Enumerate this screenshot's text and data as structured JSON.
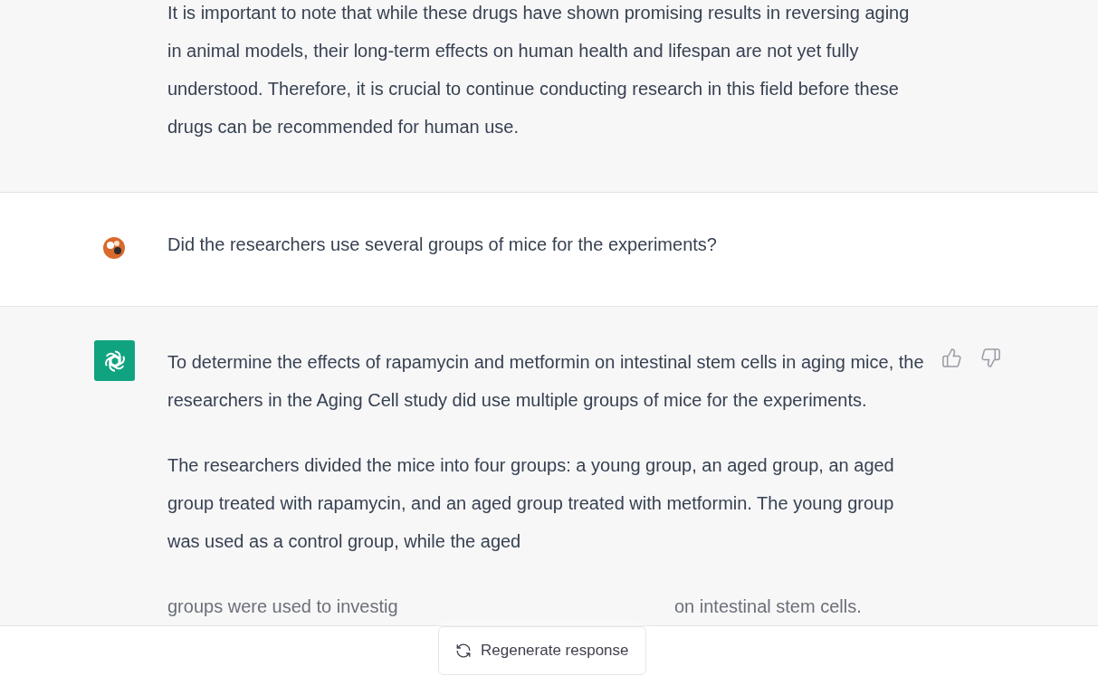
{
  "messages": [
    {
      "kind": "assistant",
      "paragraphs": [
        "It is important to note that while these drugs have shown promising results in reversing aging in animal models, their long-term effects on human health and lifespan are not yet fully understood. Therefore, it is crucial to continue conducting research in this field before these drugs can be recommended for human use."
      ]
    },
    {
      "kind": "user",
      "paragraphs": [
        "Did the researchers use  several groups of mice for the experiments?"
      ]
    },
    {
      "kind": "assistant",
      "feedback": true,
      "paragraphs": [
        "To determine the effects of rapamycin and metformin on intestinal stem cells in aging mice, the researchers in the Aging Cell study did use multiple groups of mice for the experiments.",
        "The researchers divided the mice into four groups: a young group, an aged group, an aged group treated with rapamycin, and an aged group treated with metformin. The young group was used as a control group, while the aged"
      ],
      "last_line": [
        "groups were used to investig",
        "on intestinal stem cells."
      ]
    }
  ],
  "regenerate_button": {
    "label": "Regenerate response"
  }
}
